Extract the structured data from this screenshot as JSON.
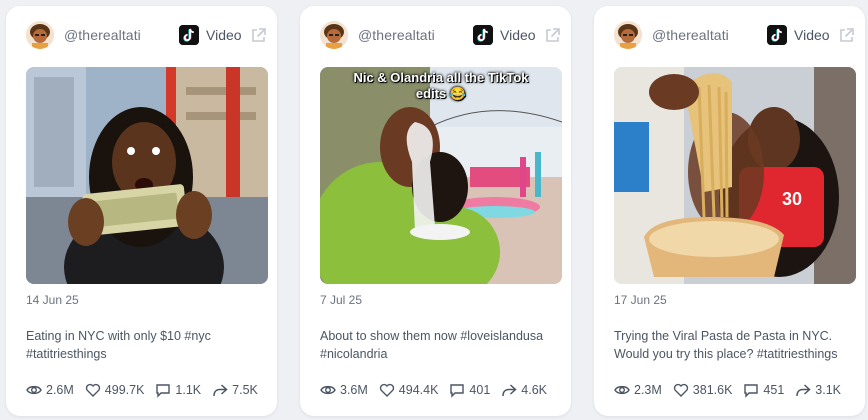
{
  "cards": [
    {
      "username": "@therealtati",
      "type_label": "Video",
      "date": "14 Jun 25",
      "description": "Eating in NYC with only $10 #nyc #tatitriesthings",
      "thumbnail_caption": "",
      "stats": {
        "views": "2.6M",
        "likes": "499.7K",
        "comments": "1.1K",
        "shares": "7.5K"
      }
    },
    {
      "username": "@therealtati",
      "type_label": "Video",
      "date": "7 Jul 25",
      "description": "About to show them now #loveislandusa #nicolandria",
      "thumbnail_caption": "Nic & Olandria all the TikTok edits 😂",
      "stats": {
        "views": "3.6M",
        "likes": "494.4K",
        "comments": "401",
        "shares": "4.6K"
      }
    },
    {
      "username": "@therealtati",
      "type_label": "Video",
      "date": "17 Jun 25",
      "description": "Trying the Viral Pasta de Pasta in NYC. Would you try this place? #tatitriesthings",
      "thumbnail_caption": "",
      "stats": {
        "views": "2.3M",
        "likes": "381.6K",
        "comments": "451",
        "shares": "3.1K"
      }
    }
  ],
  "colors": {
    "background": "#eef0f4",
    "card": "#ffffff",
    "text_muted": "#6b7280",
    "text": "#4b5563"
  },
  "icons": [
    "avatar",
    "tiktok-logo-icon",
    "external-link-icon",
    "eye-icon",
    "heart-icon",
    "comment-icon",
    "share-icon"
  ]
}
